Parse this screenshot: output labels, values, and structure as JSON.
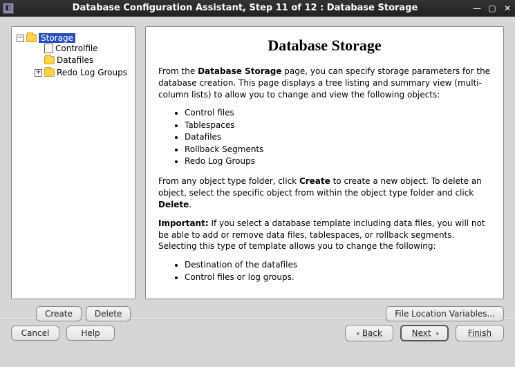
{
  "window": {
    "title": "Database Configuration Assistant, Step 11 of 12 : Database Storage"
  },
  "tree": {
    "root": {
      "label": "Storage"
    },
    "children": [
      {
        "label": "Controlfile"
      },
      {
        "label": "Datafiles"
      },
      {
        "label": "Redo Log Groups"
      }
    ]
  },
  "page": {
    "heading": "Database Storage",
    "intro_prefix": "From the ",
    "intro_bold": "Database Storage",
    "intro_suffix": " page, you can specify storage parameters for the database creation. This page displays a tree listing and summary view (multi-column lists) to allow you to change and view the following objects:",
    "objects": [
      "Control files",
      "Tablespaces",
      "Datafiles",
      "Rollback Segments",
      "Redo Log Groups"
    ],
    "para2_a": "From any object type folder, click ",
    "para2_b": "Create",
    "para2_c": " to create a new object. To delete an object, select the specific object from within the object type folder and click ",
    "para2_d": "Delete",
    "para2_e": ".",
    "para3_a": "Important:",
    "para3_b": " If you select a database template including data files, you will not be able to add or remove data files, tablespaces, or rollback segments. Selecting this type of template allows you to change the following:",
    "changeable": [
      "Destination of the datafiles",
      "Control files or log groups."
    ]
  },
  "buttons": {
    "create": "Create",
    "delete": "Delete",
    "file_loc": "File Location Variables...",
    "cancel": "Cancel",
    "help": "Help",
    "back": "Back",
    "next": "Next",
    "finish": "Finish"
  }
}
